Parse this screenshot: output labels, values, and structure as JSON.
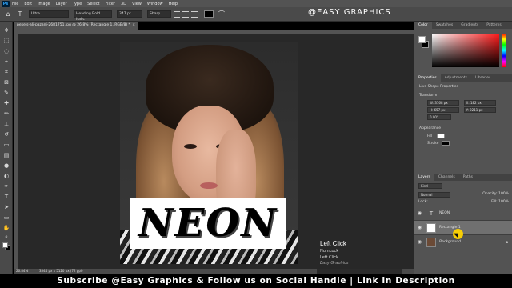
{
  "menubar": {
    "logo": "Ps",
    "items": [
      "File",
      "Edit",
      "Image",
      "Layer",
      "Type",
      "Select",
      "Filter",
      "3D",
      "View",
      "Window",
      "Help"
    ]
  },
  "options_bar": {
    "tool_icon": "T",
    "font_family": "Ultra",
    "font_style": "Heading Bold Italic",
    "font_size": "347 pt",
    "antialias": "Sharp",
    "text_color": "#000000"
  },
  "watermark": "@EASY GRAPHICS",
  "document": {
    "tab_label": "pexels-ali-pazani-2681751.jpg @ 26.8% (Rectangle 1, RGB/8) *",
    "zoom": "26.84%",
    "status": "3544 px x 5120 px (72 ppi)"
  },
  "canvas": {
    "neon_text": "NEON"
  },
  "keycast": {
    "title": "Left Click",
    "line1": "NumLock",
    "line2": "Left Click",
    "brand": "Easy Graphics"
  },
  "panels": {
    "color_tabs": [
      "Color",
      "Swatches",
      "Gradients",
      "Patterns"
    ],
    "properties_tabs": [
      "Properties",
      "Adjustments",
      "Libraries"
    ],
    "live_shape": "Live Shape Properties",
    "transform_label": "Transform",
    "w": "W: 3168 px",
    "h": "H: 657 px",
    "x": "X: 182 px",
    "y": "Y: 2211 px",
    "angle": "0.00°",
    "appearance_label": "Appearance",
    "fill_label": "Fill",
    "stroke_label": "Stroke",
    "layers_tabs": [
      "Layers",
      "Channels",
      "Paths"
    ],
    "kind": "Kind",
    "blend": "Normal",
    "opacity": "Opacity: 100%",
    "lock": "Lock:",
    "fill": "Fill: 100%",
    "layers": [
      {
        "name": "NEON",
        "type": "text"
      },
      {
        "name": "Rectangle 1",
        "type": "shape"
      },
      {
        "name": "Background",
        "type": "image"
      }
    ]
  },
  "banner": "Subscribe @Easy Graphics & Follow us on Social Handle | Link In Description"
}
